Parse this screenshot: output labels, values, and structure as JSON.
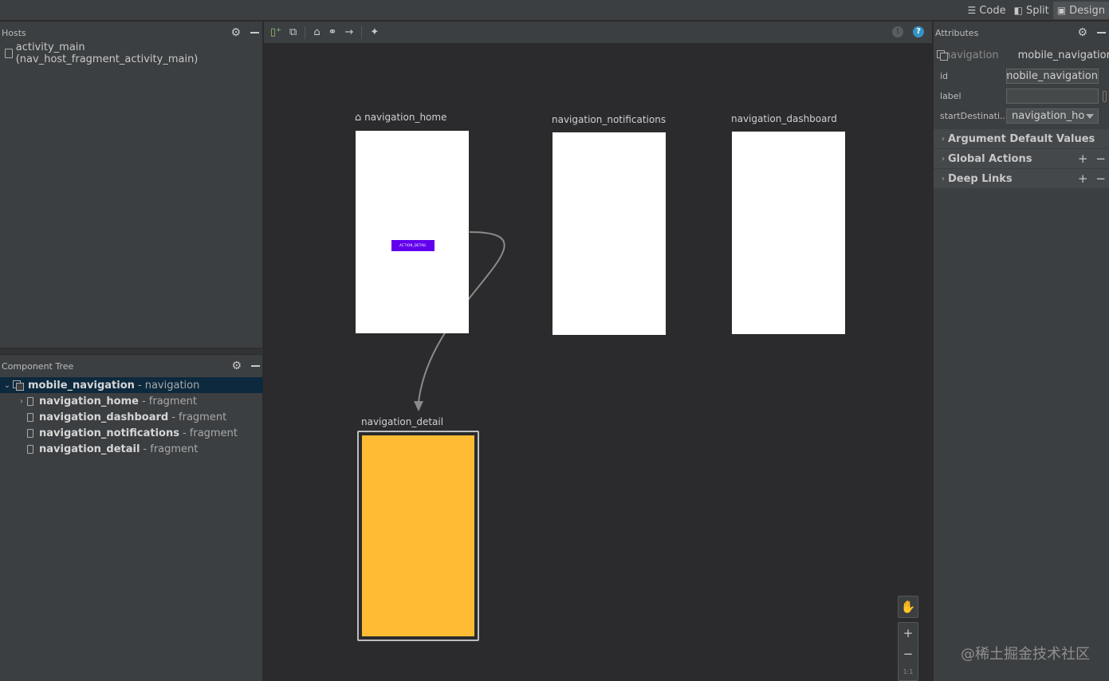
{
  "view_switch": {
    "code": "Code",
    "split": "Split",
    "design": "Design"
  },
  "hosts": {
    "title": "Hosts",
    "item": "activity_main (nav_host_fragment_activity_main)"
  },
  "component_tree": {
    "title": "Component Tree",
    "root": {
      "name": "mobile_navigation",
      "type": "- navigation"
    },
    "children": [
      {
        "name": "navigation_home",
        "type": "- fragment"
      },
      {
        "name": "navigation_dashboard",
        "type": "- fragment"
      },
      {
        "name": "navigation_notifications",
        "type": "- fragment"
      },
      {
        "name": "navigation_detail",
        "type": "- fragment"
      }
    ]
  },
  "canvas": {
    "destinations": [
      {
        "label": "navigation_home",
        "start": true
      },
      {
        "label": "navigation_notifications"
      },
      {
        "label": "navigation_dashboard"
      },
      {
        "label": "navigation_detail",
        "selected": true
      }
    ],
    "action_button": "ACTION_DETAIL",
    "zoom_fit": "1:1",
    "colors": {
      "action_button": "#6200ee",
      "detail_fill": "#ffbb33"
    }
  },
  "attributes": {
    "title": "Attributes",
    "type": "navigation",
    "name": "mobile_navigation",
    "fields": [
      {
        "key": "id",
        "value": "mobile_navigation"
      },
      {
        "key": "label",
        "value": ""
      },
      {
        "key": "startDestinati...",
        "value": "navigation_ho"
      }
    ],
    "sections": [
      "Argument Default Values",
      "Global Actions",
      "Deep Links"
    ]
  },
  "watermark": "@稀土掘金技术社区"
}
